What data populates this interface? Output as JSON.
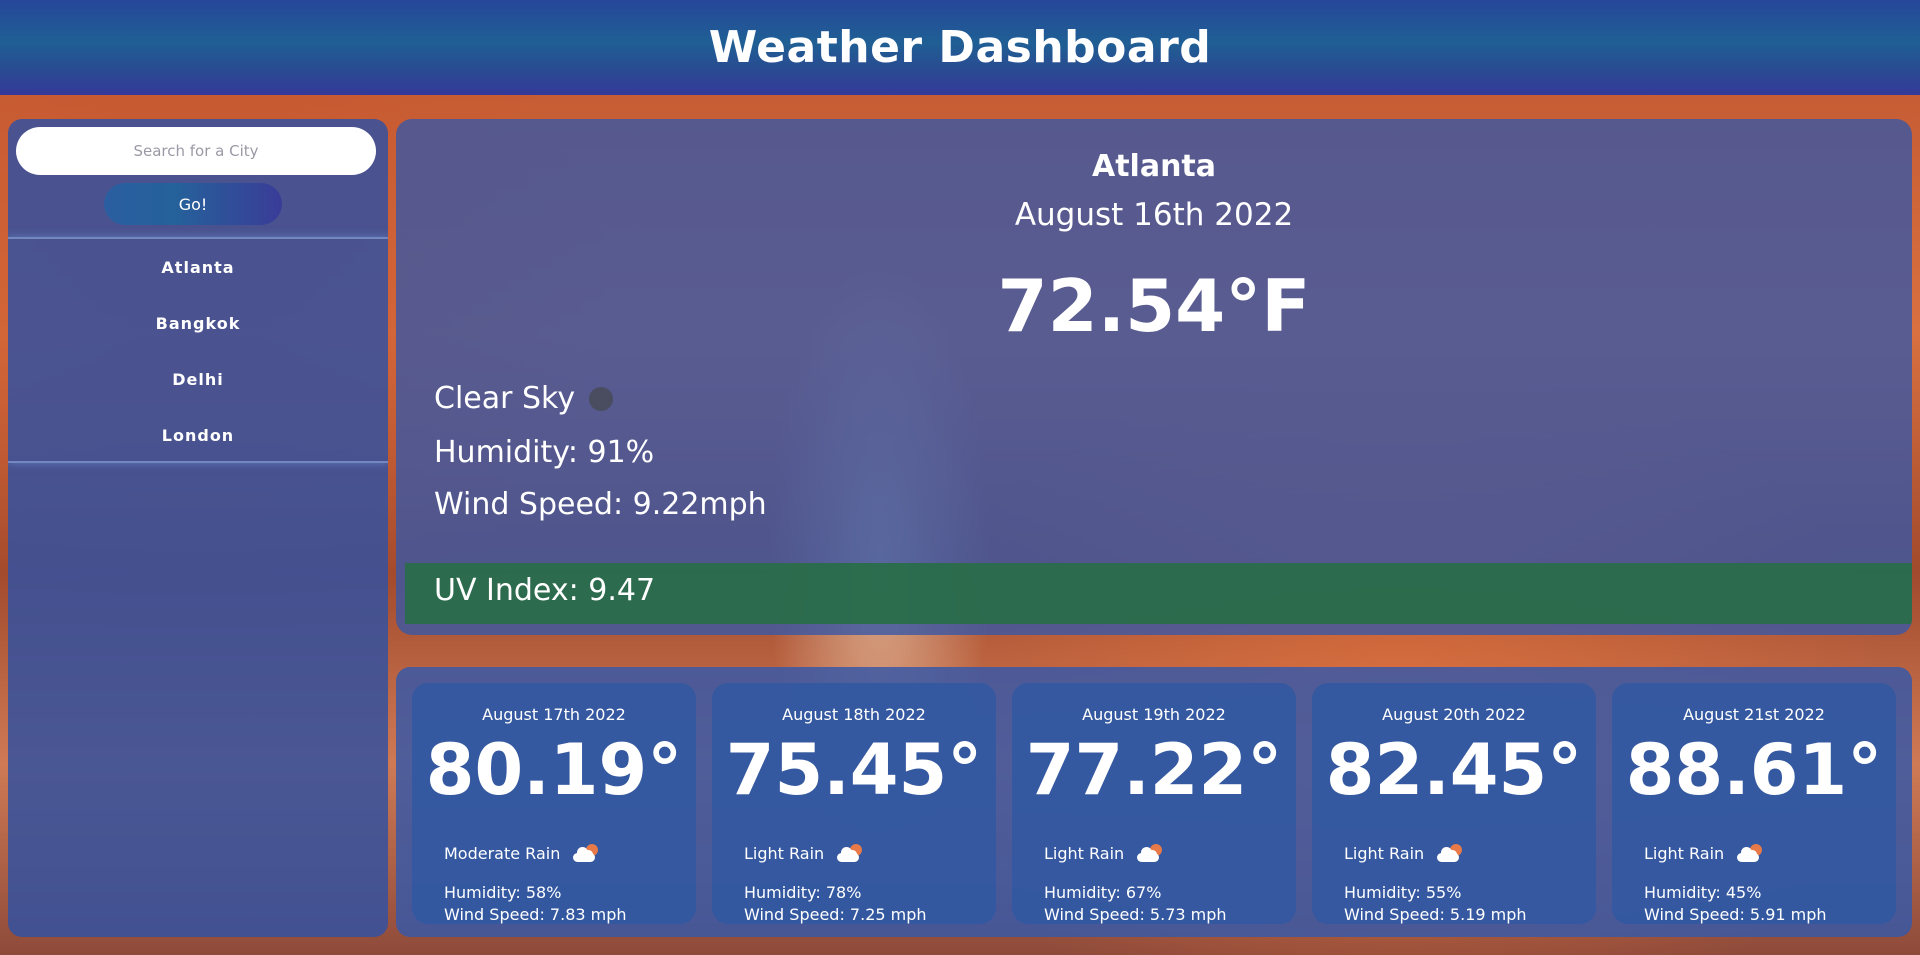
{
  "header": {
    "title": "Weather Dashboard"
  },
  "sidebar": {
    "search": {
      "placeholder": "Search for a City",
      "value": ""
    },
    "go_label": "Go!",
    "history": [
      {
        "label": "Atlanta"
      },
      {
        "label": "Bangkok"
      },
      {
        "label": "Delhi"
      },
      {
        "label": "London"
      }
    ]
  },
  "current": {
    "city": "Atlanta",
    "date": "August 16th 2022",
    "temperature": "72.54°F",
    "condition": "Clear Sky",
    "condition_icon": "weather-condition-icon",
    "humidity": "Humidity: 91%",
    "wind": "Wind Speed: 9.22mph",
    "uv": "UV Index: 9.47",
    "uv_color": "#286e46"
  },
  "forecast": [
    {
      "date": "August 17th 2022",
      "temp": "80.19°",
      "condition": "Moderate Rain",
      "icon": "cloud-sun-icon",
      "humidity": "Humidity: 58%",
      "wind": "Wind Speed: 7.83 mph"
    },
    {
      "date": "August 18th 2022",
      "temp": "75.45°",
      "condition": "Light Rain",
      "icon": "cloud-sun-icon",
      "humidity": "Humidity: 78%",
      "wind": "Wind Speed: 7.25 mph"
    },
    {
      "date": "August 19th 2022",
      "temp": "77.22°",
      "condition": "Light Rain",
      "icon": "cloud-sun-icon",
      "humidity": "Humidity: 67%",
      "wind": "Wind Speed: 5.73 mph"
    },
    {
      "date": "August 20th 2022",
      "temp": "82.45°",
      "condition": "Light Rain",
      "icon": "cloud-sun-icon",
      "humidity": "Humidity: 55%",
      "wind": "Wind Speed: 5.19 mph"
    },
    {
      "date": "August 21st 2022",
      "temp": "88.61°",
      "condition": "Light Rain",
      "icon": "cloud-sun-icon",
      "humidity": "Humidity: 45%",
      "wind": "Wind Speed: 5.91 mph"
    }
  ]
}
